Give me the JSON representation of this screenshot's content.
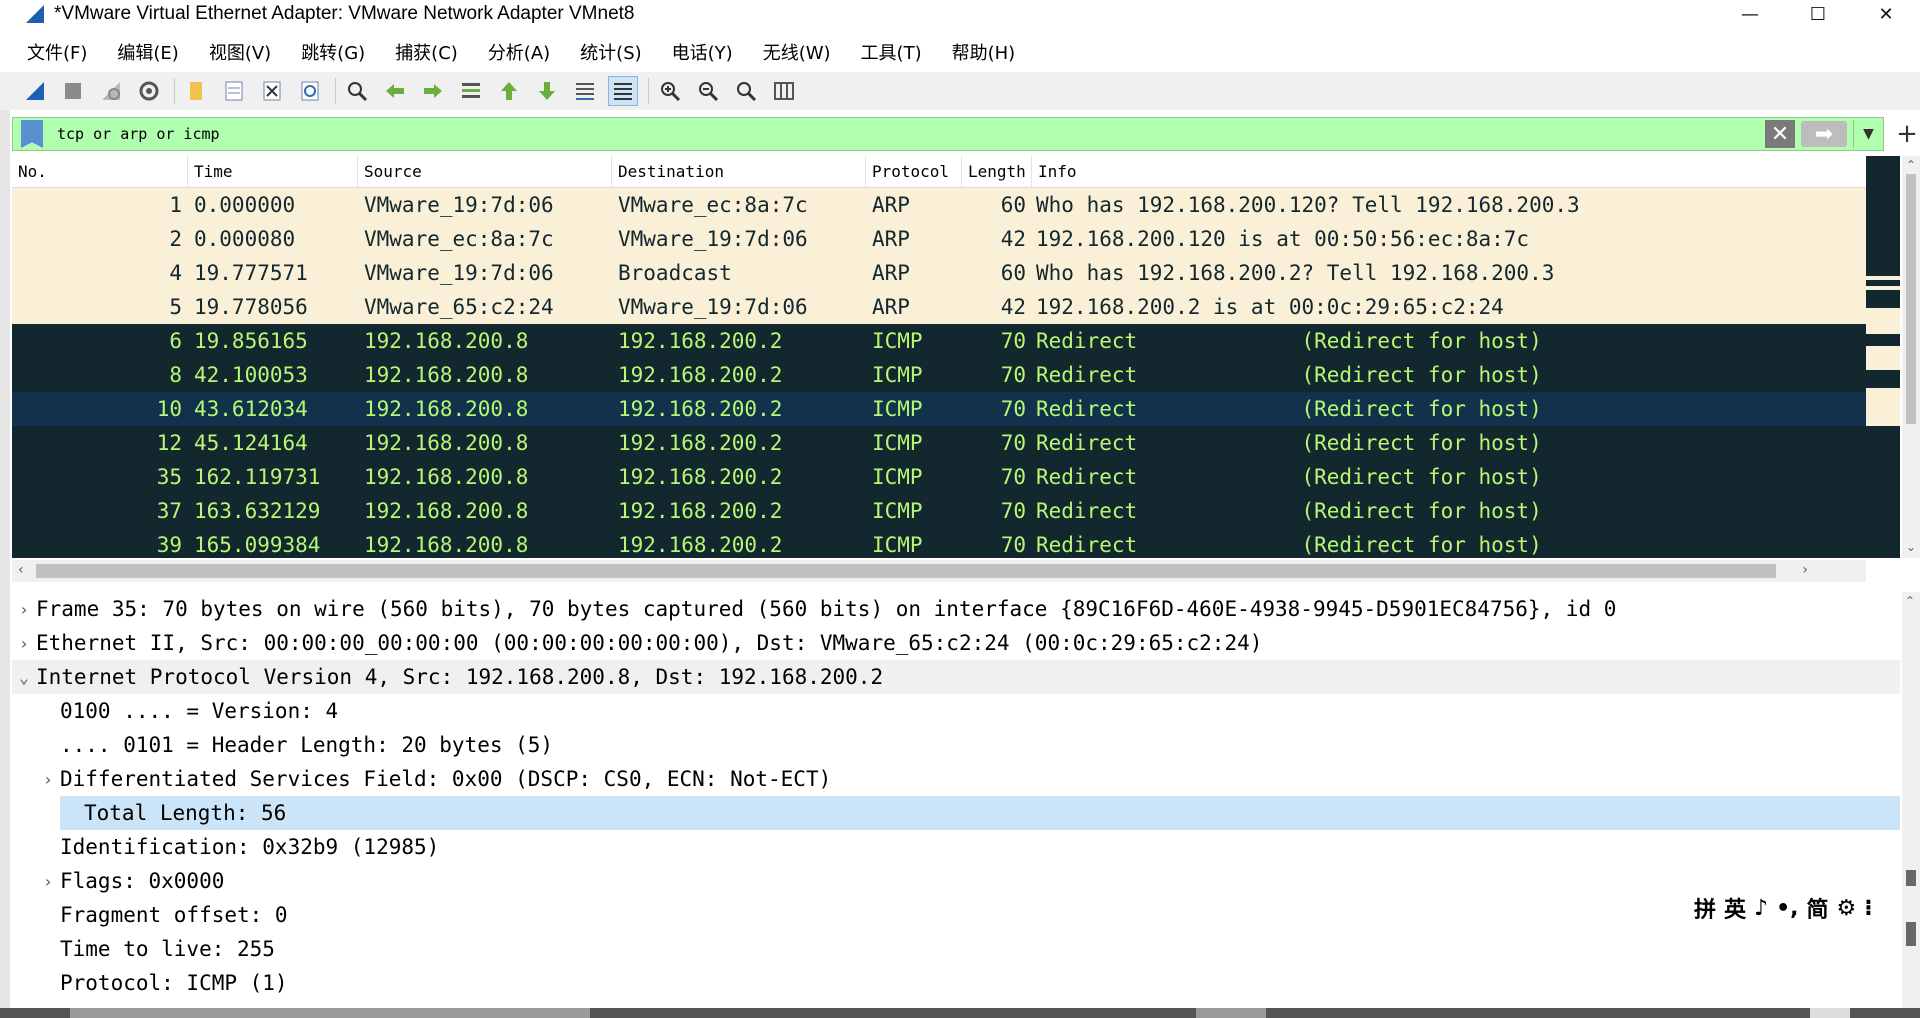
{
  "window": {
    "title": "*VMware Virtual Ethernet Adapter: VMware Network Adapter VMnet8",
    "minimize": "—",
    "maximize": "☐",
    "close": "✕"
  },
  "menu": [
    "文件(F)",
    "编辑(E)",
    "视图(V)",
    "跳转(G)",
    "捕获(C)",
    "分析(A)",
    "统计(S)",
    "电话(Y)",
    "无线(W)",
    "工具(T)",
    "帮助(H)"
  ],
  "filter": {
    "value": "tcp or arp or icmp",
    "clear": "✕",
    "apply": "➡",
    "dropdown": "▼",
    "add": "+"
  },
  "packet_list": {
    "columns": [
      "No.",
      "Time",
      "Source",
      "Destination",
      "Protocol",
      "Length",
      "Info"
    ],
    "rows": [
      {
        "no": "1",
        "time": "0.000000",
        "src": "VMware_19:7d:06",
        "dst": "VMware_ec:8a:7c",
        "proto": "ARP",
        "len": "60",
        "info": "Who has 192.168.200.120? Tell 192.168.200.3"
      },
      {
        "no": "2",
        "time": "0.000080",
        "src": "VMware_ec:8a:7c",
        "dst": "VMware_19:7d:06",
        "proto": "ARP",
        "len": "42",
        "info": "192.168.200.120 is at 00:50:56:ec:8a:7c"
      },
      {
        "no": "4",
        "time": "19.777571",
        "src": "VMware_19:7d:06",
        "dst": "Broadcast",
        "proto": "ARP",
        "len": "60",
        "info": "Who has 192.168.200.2? Tell 192.168.200.3"
      },
      {
        "no": "5",
        "time": "19.778056",
        "src": "VMware_65:c2:24",
        "dst": "VMware_19:7d:06",
        "proto": "ARP",
        "len": "42",
        "info": "192.168.200.2 is at 00:0c:29:65:c2:24"
      },
      {
        "no": "6",
        "time": "19.856165",
        "src": "192.168.200.8",
        "dst": "192.168.200.2",
        "proto": "ICMP",
        "len": "70",
        "info": "Redirect             (Redirect for host)"
      },
      {
        "no": "8",
        "time": "42.100053",
        "src": "192.168.200.8",
        "dst": "192.168.200.2",
        "proto": "ICMP",
        "len": "70",
        "info": "Redirect             (Redirect for host)"
      },
      {
        "no": "10",
        "time": "43.612034",
        "src": "192.168.200.8",
        "dst": "192.168.200.2",
        "proto": "ICMP",
        "len": "70",
        "info": "Redirect             (Redirect for host)"
      },
      {
        "no": "12",
        "time": "45.124164",
        "src": "192.168.200.8",
        "dst": "192.168.200.2",
        "proto": "ICMP",
        "len": "70",
        "info": "Redirect             (Redirect for host)"
      },
      {
        "no": "35",
        "time": "162.119731",
        "src": "192.168.200.8",
        "dst": "192.168.200.2",
        "proto": "ICMP",
        "len": "70",
        "info": "Redirect             (Redirect for host)"
      },
      {
        "no": "37",
        "time": "163.632129",
        "src": "192.168.200.8",
        "dst": "192.168.200.2",
        "proto": "ICMP",
        "len": "70",
        "info": "Redirect             (Redirect for host)"
      },
      {
        "no": "39",
        "time": "165.099384",
        "src": "192.168.200.8",
        "dst": "192.168.200.2",
        "proto": "ICMP",
        "len": "70",
        "info": "Redirect             (Redirect for host)"
      }
    ]
  },
  "details": [
    {
      "text": "Frame 35: 70 bytes on wire (560 bits), 70 bytes captured (560 bits) on interface {89C16F6D-460E-4938-9945-D5901EC84756}, id 0",
      "caret": "›"
    },
    {
      "text": "Ethernet II, Src: 00:00:00_00:00:00 (00:00:00:00:00:00), Dst: VMware_65:c2:24 (00:0c:29:65:c2:24)",
      "caret": "›"
    },
    {
      "text": "Internet Protocol Version 4, Src: 192.168.200.8, Dst: 192.168.200.2",
      "caret": "⌄"
    },
    {
      "text": "0100 .... = Version: 4",
      "caret": ""
    },
    {
      "text": ".... 0101 = Header Length: 20 bytes (5)",
      "caret": ""
    },
    {
      "text": "Differentiated Services Field: 0x00 (DSCP: CS0, ECN: Not-ECT)",
      "caret": "›"
    },
    {
      "text": "Total Length: 56",
      "caret": ""
    },
    {
      "text": "Identification: 0x32b9 (12985)",
      "caret": ""
    },
    {
      "text": "Flags: 0x0000",
      "caret": "›"
    },
    {
      "text": "Fragment offset: 0",
      "caret": ""
    },
    {
      "text": "Time to live: 255",
      "caret": ""
    },
    {
      "text": "Protocol: ICMP (1)",
      "caret": ""
    }
  ],
  "ime": [
    "拼",
    "英",
    "♪",
    "•,",
    "简",
    "⚙",
    "⁝"
  ],
  "colors": {
    "arp_row_bg": "#faf0d7",
    "icmp_row_bg": "#12272e",
    "icmp_row_fg": "#b7f774",
    "selected_row_bg": "#11324a",
    "filter_bg": "#afffaf",
    "detail_selected_bg": "#cce4f7"
  }
}
